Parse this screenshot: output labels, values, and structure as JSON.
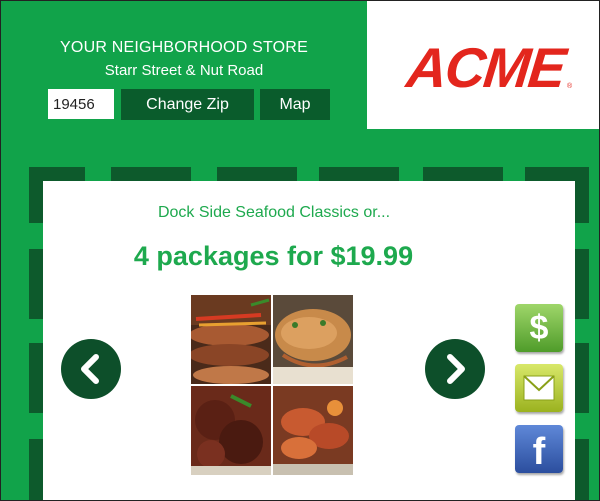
{
  "header": {
    "store_label": "YOUR NEIGHBORHOOD STORE",
    "store_address": "Starr Street & Nut Road",
    "zip_value": "19456",
    "change_zip_label": "Change Zip",
    "map_label": "Map"
  },
  "brand": {
    "logo_text": "ACME",
    "logo_reg": "®",
    "logo_color": "#e3261d"
  },
  "deal": {
    "subtitle": "Dock Side Seafood Classics or...",
    "price": "4 packages for $19.99",
    "text_color": "#1ea94e"
  },
  "share": {
    "dollar_glyph": "$",
    "facebook_glyph": "f"
  },
  "icons": [
    "chevron-left-icon",
    "chevron-right-icon",
    "dollar-icon",
    "envelope-icon",
    "facebook-icon"
  ],
  "colors": {
    "brand_green": "#11a34a",
    "dark_green": "#0a5c2c",
    "nav_green": "#0d4f2a"
  }
}
